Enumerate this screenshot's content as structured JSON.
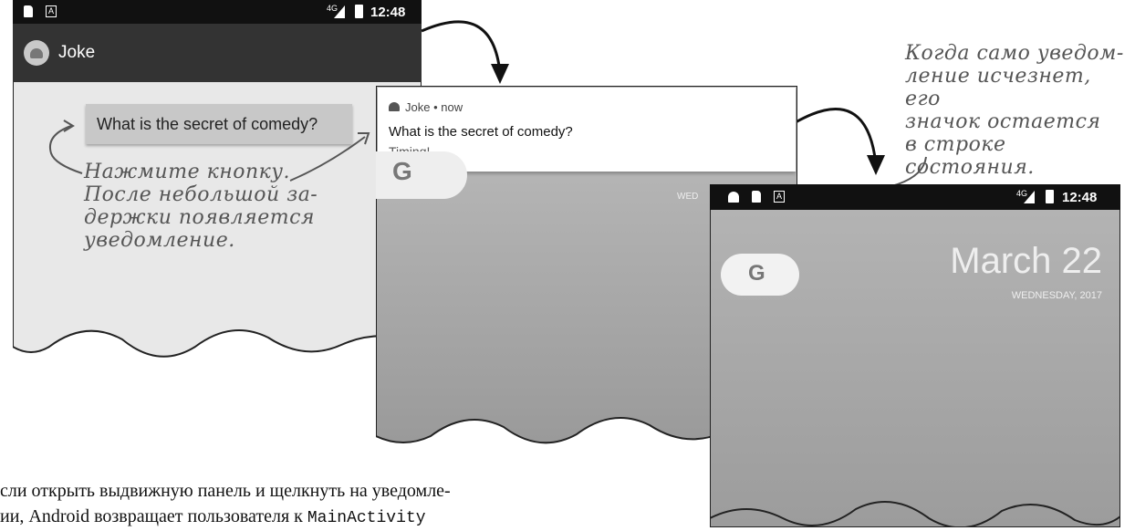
{
  "screen1": {
    "status_time": "12:48",
    "status_network": "4G",
    "app_title": "Joke",
    "button_label": "What is the secret of comedy?"
  },
  "screen2": {
    "notif_app_line": "Joke • now",
    "notif_title": "What is the secret of comedy?",
    "notif_text": "Timing!",
    "date_fragment": "WED"
  },
  "screen3": {
    "status_time": "12:48",
    "status_network": "4G",
    "google_letter": "G",
    "date_big": "March 22",
    "date_small": "WEDNESDAY, 2017"
  },
  "annotations": {
    "left": [
      "Нажмите кнопку.",
      "После небольшой за-",
      "держки появляется",
      "уведомление."
    ],
    "right": [
      "Когда само уведом-",
      "ление исчезнет, его",
      "значок остается",
      "в строке состояния."
    ]
  },
  "caption": {
    "line1": "сли открыть выдвижную панель и щелкнуть на уведомле-",
    "line2": "ии, Android возвращает пользователя к",
    "line2_code": "MainActivity"
  },
  "colors": {
    "status_bar": "#111111",
    "app_bar": "#333333",
    "app_bg": "#e8e8e8",
    "button_bg": "#c8c8c8",
    "home_gray": "#aaaaaa"
  }
}
